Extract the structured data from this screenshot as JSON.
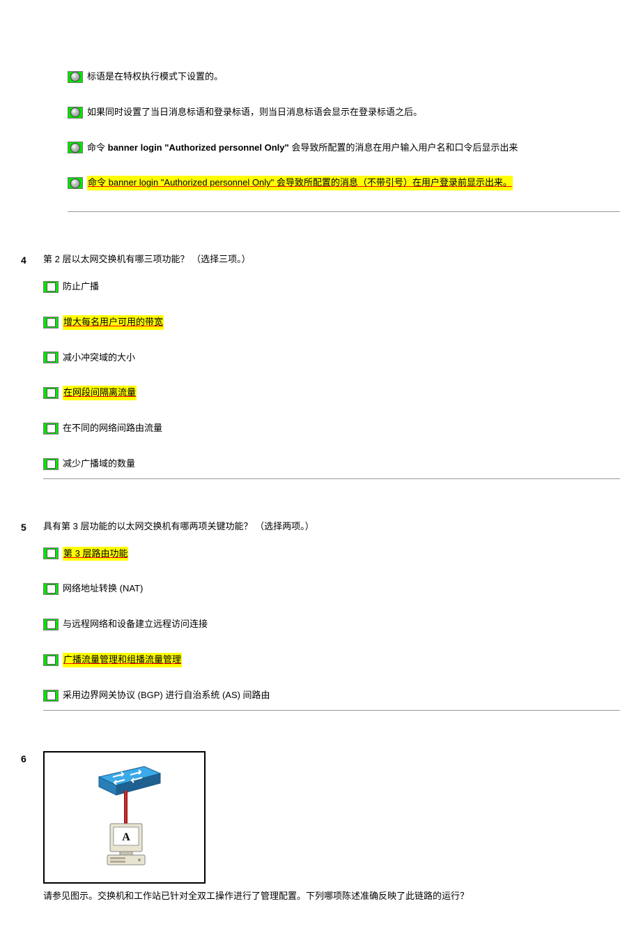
{
  "q3": {
    "options": [
      {
        "hl": false,
        "text": "标语是在特权执行模式下设置的。"
      },
      {
        "hl": false,
        "text": "如果同时设置了当日消息标语和登录标语，则当日消息标语会显示在登录标语之后。"
      },
      {
        "hl": false,
        "prefix": "命令 ",
        "cmd": "banner login \"Authorized personnel Only\"",
        "suffix": " 会导致所配置的消息在用户输入用户名和口令后显示出来"
      },
      {
        "hl": true,
        "text": "命令 banner login \"Authorized personnel Only\" 会导致所配置的消息（不带引号）在用户登录前显示出来。"
      }
    ]
  },
  "q4": {
    "number": "4",
    "text": "第 2 层以太网交换机有哪三项功能？ （选择三项。）",
    "options": [
      {
        "hl": false,
        "text": "防止广播"
      },
      {
        "hl": true,
        "text": "增大每名用户可用的带宽"
      },
      {
        "hl": true,
        "text": "减小冲突域的大小"
      },
      {
        "hl": true,
        "text": "在网段间隔离流量"
      },
      {
        "hl": false,
        "text": "在不同的网络间路由流量"
      },
      {
        "hl": false,
        "text": "减少广播域的数量"
      }
    ]
  },
  "q5": {
    "number": "5",
    "text": "具有第 3 层功能的以太网交换机有哪两项关键功能？ （选择两项。）",
    "options": [
      {
        "hl": true,
        "text": "第 3 层路由功能"
      },
      {
        "hl": false,
        "text": "网络地址转换 (NAT)"
      },
      {
        "hl": false,
        "text": "与远程网络和设备建立远程访问连接"
      },
      {
        "hl": true,
        "text": "广播流量管理和组播流量管理"
      },
      {
        "hl": false,
        "text": "采用边界网关协议 (BGP) 进行自治系统 (AS) 间路由"
      }
    ]
  },
  "q6": {
    "number": "6",
    "caption": "请参见图示。交换机和工作站已针对全双工操作进行了管理配置。下列哪项陈述准确反映了此链路的运行？",
    "label_a": "A"
  }
}
